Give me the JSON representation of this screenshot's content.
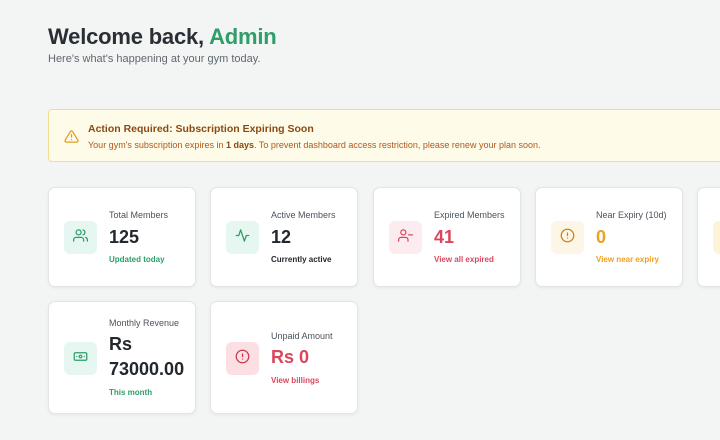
{
  "header": {
    "greeting": "Welcome back,",
    "user_name": "Admin",
    "subtitle": "Here's what's happening at your gym today."
  },
  "alert": {
    "icon": "warning-triangle-icon",
    "title": "Action Required: Subscription Expiring Soon",
    "text_before": "Your gym's subscription expires in ",
    "days": "1 days",
    "text_after": ". To prevent dashboard access restriction, please renew your plan soon."
  },
  "cards": {
    "total_members": {
      "label": "Total Members",
      "value": "125",
      "sub": "Updated today",
      "icon": "users-icon"
    },
    "active_members": {
      "label": "Active Members",
      "value": "12",
      "sub": "Currently active",
      "icon": "activity-icon"
    },
    "expired_members": {
      "label": "Expired Members",
      "value": "41",
      "sub": "View all expired",
      "icon": "user-minus-icon"
    },
    "near_expiry": {
      "label": "Near Expiry (10d)",
      "value": "0",
      "sub": "View near expiry",
      "icon": "alert-circle-icon"
    },
    "monthly_revenue": {
      "label": "Monthly Revenue",
      "value_line1": "Rs",
      "value_line2": "73000.00",
      "sub": "This month",
      "icon": "banknote-icon"
    },
    "unpaid_amount": {
      "label": "Unpaid Amount",
      "value": "Rs 0",
      "sub": "View billings",
      "icon": "alert-circle-icon"
    }
  },
  "colors": {
    "brand_green": "#2e9e6a",
    "danger_red": "#d9475c",
    "warning_orange": "#f0a020",
    "alert_bg": "#fefbe9"
  }
}
